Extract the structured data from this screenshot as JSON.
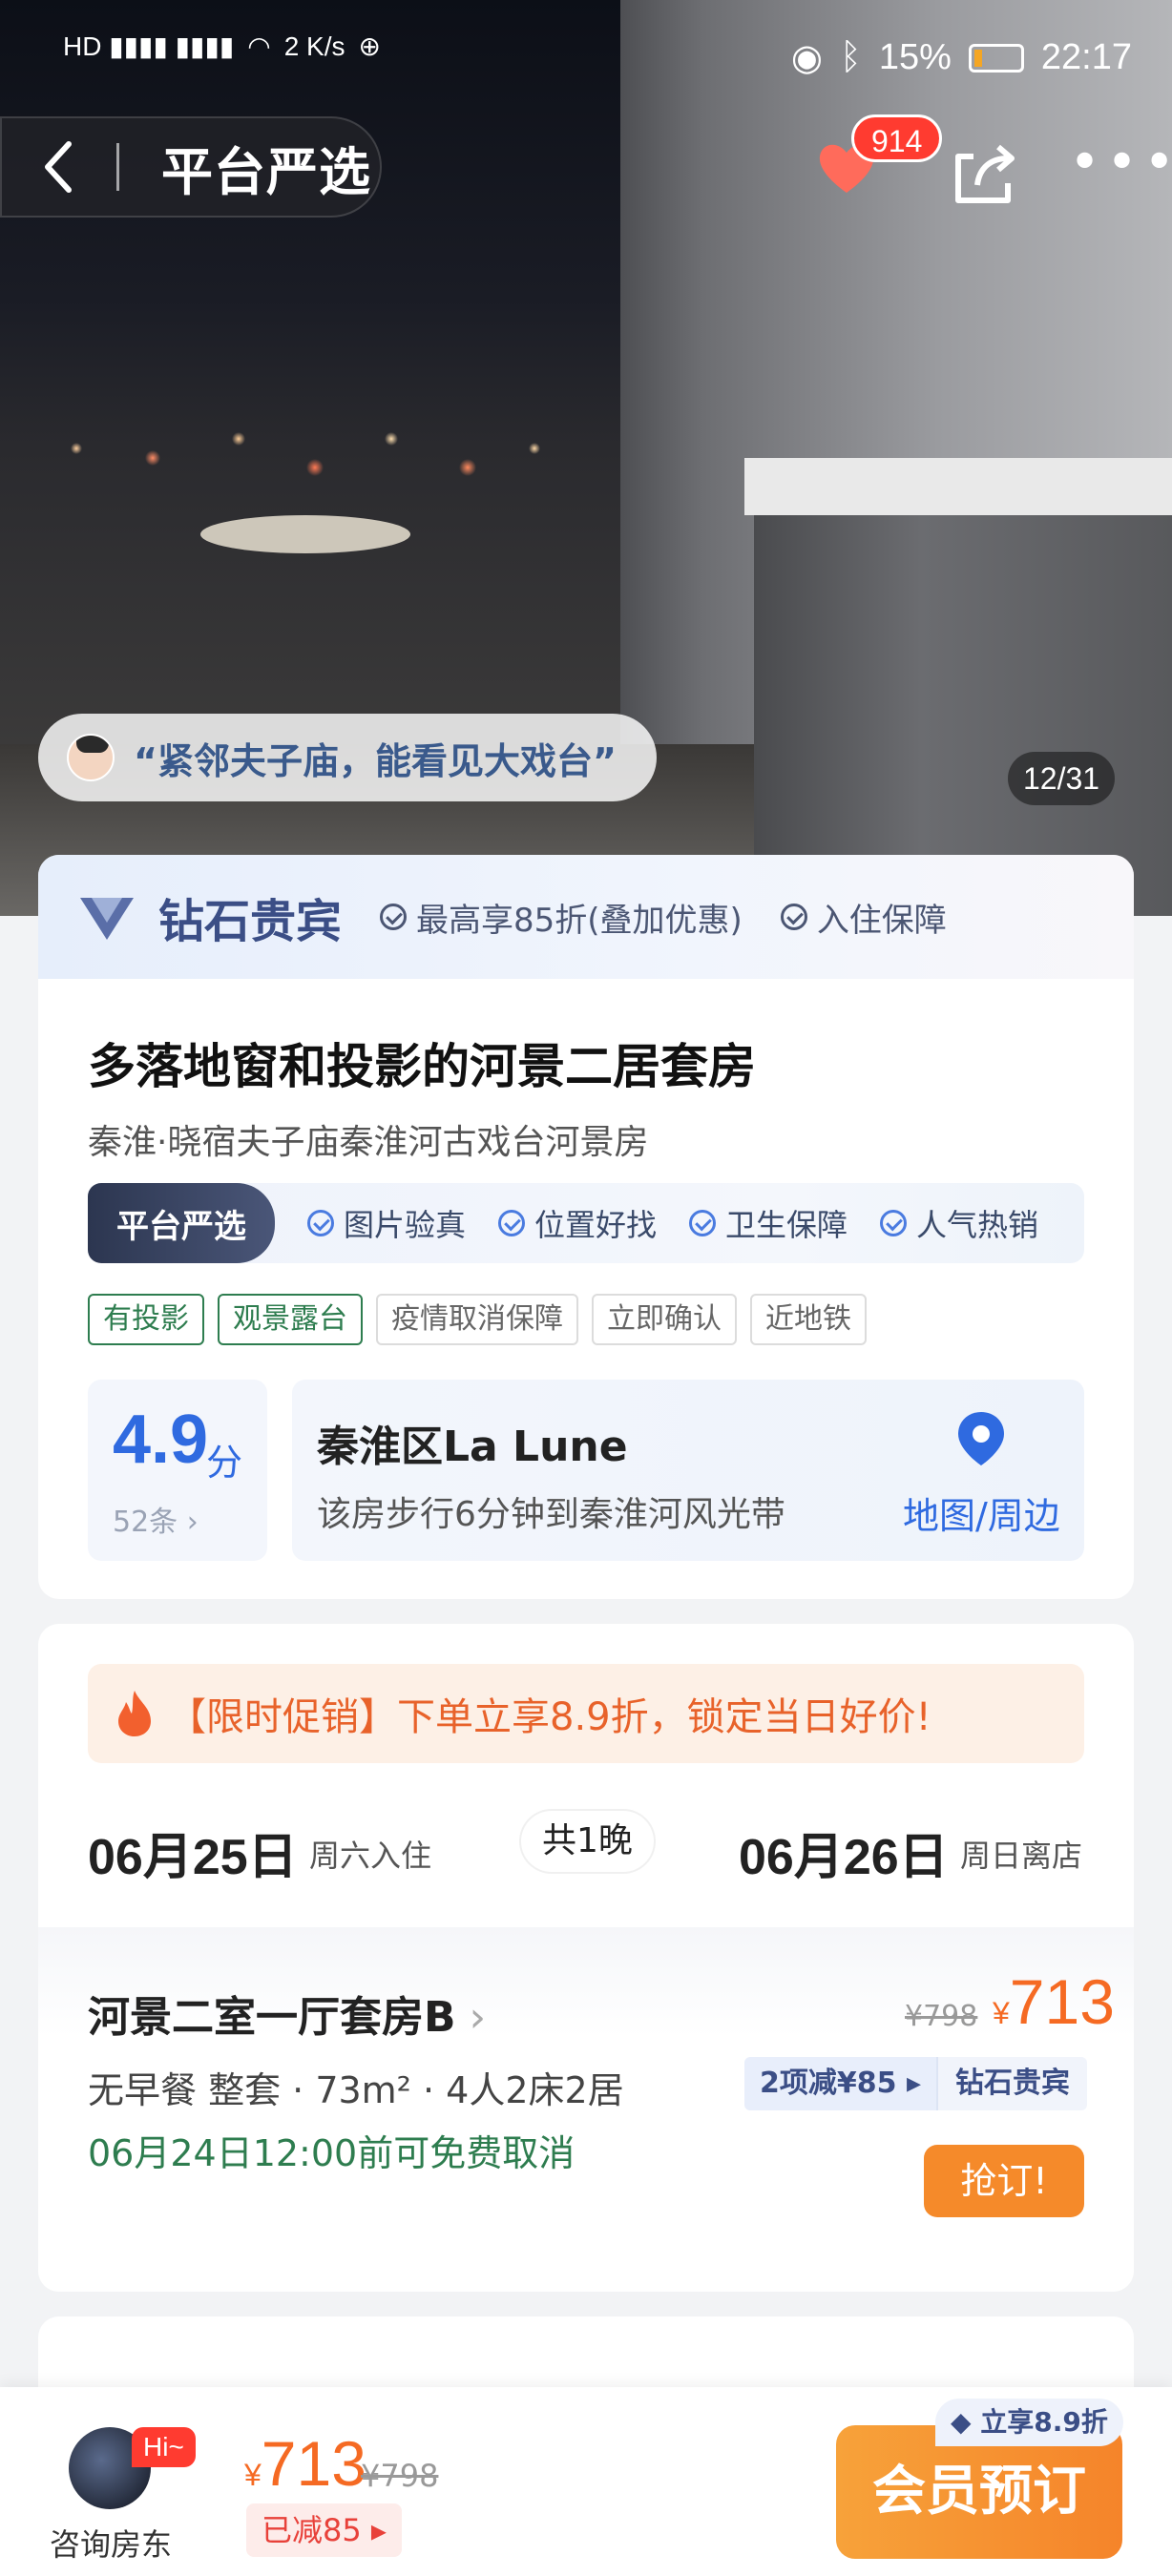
{
  "status_bar": {
    "net_speed": "2 K/s",
    "battery": "15%",
    "time": "22:17"
  },
  "nav": {
    "brand": "平台严选",
    "favorites_count": "914"
  },
  "hero": {
    "quote": "“紧邻夫子庙，能看见大戏台”",
    "photo_counter": "12/31"
  },
  "vip": {
    "title": "钻石贵宾",
    "perk1": "最高享85折(叠加优惠)",
    "perk2": "入住保障"
  },
  "listing": {
    "title": "多落地窗和投影的河景二居套房",
    "subtitle": "秦淮·晓宿夫子庙秦淮河古戏台河景房",
    "platform_tag": "平台严选",
    "features": [
      "图片验真",
      "位置好找",
      "卫生保障",
      "人气热销"
    ],
    "tags": [
      "有投影",
      "观景露台",
      "疫情取消保障",
      "立即确认",
      "近地铁"
    ],
    "score": "4.9",
    "score_unit": "分",
    "reviews": "52条",
    "location_name": "秦淮区La Lune",
    "location_desc": "该房步行6分钟到秦淮河风光带",
    "map_link": "地图/周边"
  },
  "booking": {
    "promo": "【限时促销】下单立享8.9折，锁定当日好价!",
    "checkin_date": "06月25日",
    "checkin_label": "周六入住",
    "nights": "共1晚",
    "checkout_date": "06月26日",
    "checkout_label": "周日离店"
  },
  "room": {
    "name": "河景二室一厅套房B",
    "info": "无早餐  整套 · 73m² · 4人2床2居",
    "cancel": "06月24日12:00前可免费取消",
    "old_price": "¥798",
    "price": "713",
    "yen": "¥",
    "discount": "2项减¥85",
    "vip_label": "钻石贵宾",
    "book": "抢订!"
  },
  "bottom_bar": {
    "hi": "Hi~",
    "host": "咨询房东",
    "yen": "¥",
    "price": "713",
    "old_price": "¥798",
    "reduced": "已减85",
    "cta_badge": "立享8.9折",
    "cta": "会员预订"
  },
  "colors": {
    "accent_orange": "#f56a23",
    "vip_blue": "#3b4e86",
    "link_blue": "#2f6ae0",
    "green": "#2e7d4f"
  }
}
